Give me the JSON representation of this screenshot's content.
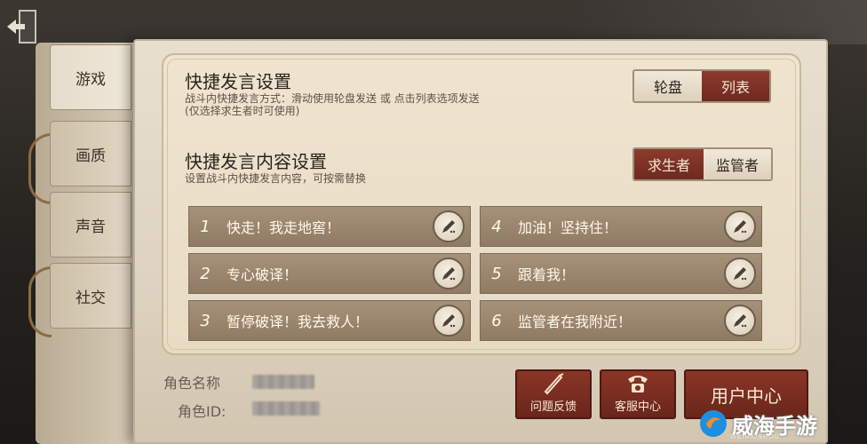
{
  "tabs": [
    {
      "label": "游戏",
      "active": true
    },
    {
      "label": "画质",
      "active": false
    },
    {
      "label": "声音",
      "active": false
    },
    {
      "label": "社交",
      "active": false
    }
  ],
  "quick_chat": {
    "title": "快捷发言设置",
    "desc1": "战斗内快捷发言方式：滑动使用轮盘发送 或 点击列表选项发送",
    "desc2": "(仅选择求生者时可使用)",
    "mode_options": [
      {
        "label": "轮盘",
        "selected": false
      },
      {
        "label": "列表",
        "selected": true
      }
    ]
  },
  "content_settings": {
    "title": "快捷发言内容设置",
    "desc": "设置战斗内快捷发言内容，可按需替换",
    "role_options": [
      {
        "label": "求生者",
        "selected": true
      },
      {
        "label": "监管者",
        "selected": false
      }
    ]
  },
  "phrases": [
    {
      "num": "1",
      "text": "快走！我走地窖！"
    },
    {
      "num": "2",
      "text": "专心破译！"
    },
    {
      "num": "3",
      "text": "暂停破译！我去救人！"
    },
    {
      "num": "4",
      "text": "加油！坚持住！"
    },
    {
      "num": "5",
      "text": "跟着我！"
    },
    {
      "num": "6",
      "text": "监管者在我附近！"
    }
  ],
  "profile": {
    "name_label": "角色名称",
    "id_label": "角色ID:"
  },
  "buttons": {
    "feedback": "问题反馈",
    "service": "客服中心",
    "user_center": "用户中心"
  },
  "watermark": {
    "text": "威海手游",
    "sub": "WEIHAISHOU..."
  },
  "colors": {
    "accent_red": "#7a2e22",
    "paper": "#e6dccb",
    "phrase_bg": "#9c876f"
  }
}
